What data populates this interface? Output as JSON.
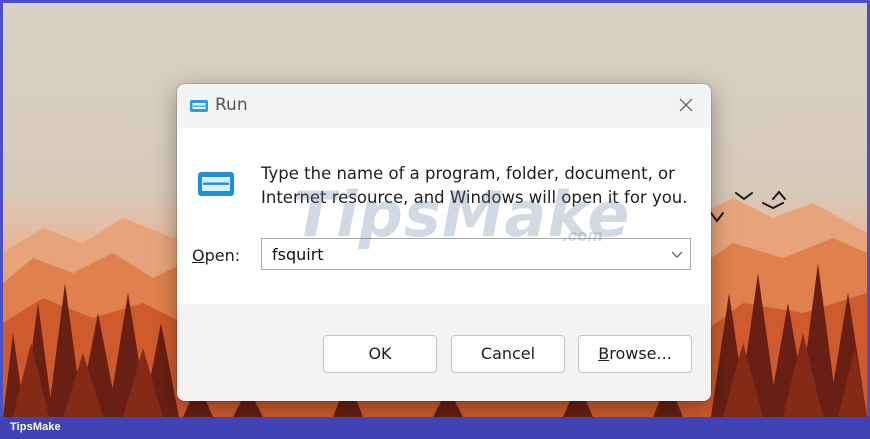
{
  "dialog": {
    "title": "Run",
    "description": "Type the name of a program, folder, document, or Internet resource, and Windows will open it for you.",
    "open_label_mnemonic": "O",
    "open_label_rest": "pen:",
    "open_value": "fsquirt",
    "ok_label": "OK",
    "cancel_label": "Cancel",
    "browse_mnemonic": "B",
    "browse_rest": "rowse..."
  },
  "icons": {
    "title": "run-icon",
    "content": "run-icon",
    "close": "close-icon",
    "dropdown": "chevron-down-icon"
  },
  "watermark": {
    "main": "TipsMake",
    "suffix": ".com"
  },
  "footer": {
    "brand": "TipsMake"
  },
  "colors": {
    "dialog_bg": "#f3f3f3",
    "content_bg": "#ffffff",
    "run_icon_blue": "#1f8fd6",
    "bottom_bar": "#3f43b3",
    "wallpaper_orange": "#e07a45"
  }
}
